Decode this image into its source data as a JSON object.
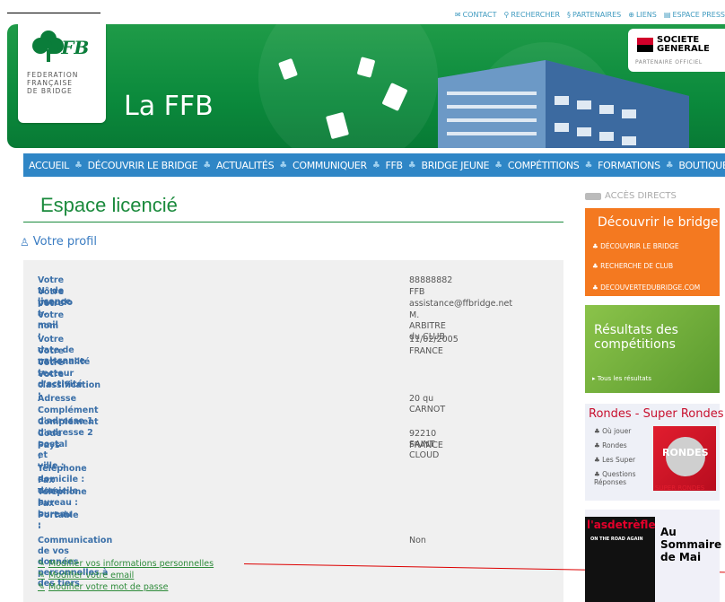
{
  "toplinks": [
    "CONTACT",
    "RECHERCHER",
    "PARTENAIRES",
    "LIENS",
    "ESPACE PRESS"
  ],
  "logo": {
    "brand": "FFB",
    "name_lines": [
      "FEDERATION",
      "FRANÇAISE",
      "DE BRIDGE"
    ]
  },
  "banner": {
    "title": "La FFB"
  },
  "sponsor": {
    "name_line1": "SOCIETE",
    "name_line2": "GENERALE",
    "subtitle": "PARTENAIRE OFFICIEL"
  },
  "nav": [
    "ACCUEIL",
    "DÉCOUVRIR LE BRIDGE",
    "ACTUALITÉS",
    "COMMUNIQUER",
    "FFB",
    "BRIDGE JEUNE",
    "COMPÉTITIONS",
    "FORMATIONS",
    "BOUTIQUE"
  ],
  "page": {
    "title": "Espace licencié",
    "section": "Votre profil"
  },
  "profile": [
    {
      "label": "Votre N° de licence :",
      "value": "88888882"
    },
    {
      "label": "Votre pseudo :",
      "value": "FFB"
    },
    {
      "label": "Votre e-mail :",
      "value": "assistance@ffbridge.net"
    },
    {
      "label": "Votre nom :",
      "value": "M. ARBITRE du CLUB"
    },
    {
      "label": "Votre date de naissance :",
      "value": "11/02/2005"
    },
    {
      "label": "Votre nationalité :",
      "value": "FRANCE"
    },
    {
      "label": "Votre secteur d'activité :",
      "value": ""
    },
    {
      "label": "Votre classification :",
      "value": ""
    },
    {
      "label": "Adresse :",
      "value": "20 qu CARNOT"
    },
    {
      "label": "Complément d'adresse 1 :",
      "value": ""
    },
    {
      "label": "Complément d'adresse 2 :",
      "value": ""
    },
    {
      "label": "Code postal et ville :",
      "value": "92210 SAINT CLOUD"
    },
    {
      "label": "Pays :",
      "value": "FRANCE"
    },
    {
      "label": "Téléphone domicile :",
      "value": ""
    },
    {
      "label": "Fax domicile :",
      "value": ""
    },
    {
      "label": "Téléphone bureau :",
      "value": ""
    },
    {
      "label": "Fax bureau :",
      "value": ""
    },
    {
      "label": "Portable :",
      "value": ""
    },
    {
      "label": "Communication de vos données personnelles à des tiers",
      "value": "Non"
    }
  ],
  "actions": [
    "Modifier vos informations personnelles",
    "Modifier votre email",
    "Modifier votre mot de passe"
  ],
  "sidebar": {
    "acces": "ACCÈS DIRECTS",
    "decouvrir_title": "Découvrir le bridge",
    "decouvrir_items": [
      "DÉCOUVRIR LE BRIDGE",
      "RECHERCHE DE CLUB",
      "DECOUVERTEDUBRIDGE.COM"
    ],
    "resultats_title": "Résultats des compétitions",
    "resultats_link": "Tous les résultats",
    "rondes_title": "Rondes - Super Rondes",
    "rondes_items": [
      "Où jouer",
      "Rondes",
      "Les Super",
      "Questions Réponses"
    ],
    "rondes_logo": "RONDES",
    "rondes_sub": "SUPER RONDES",
    "mag_logo": "l'asdetrèfle",
    "mag_cover": "ON THE ROAD AGAIN",
    "mag_text": "Au Sommaire de Mai"
  }
}
